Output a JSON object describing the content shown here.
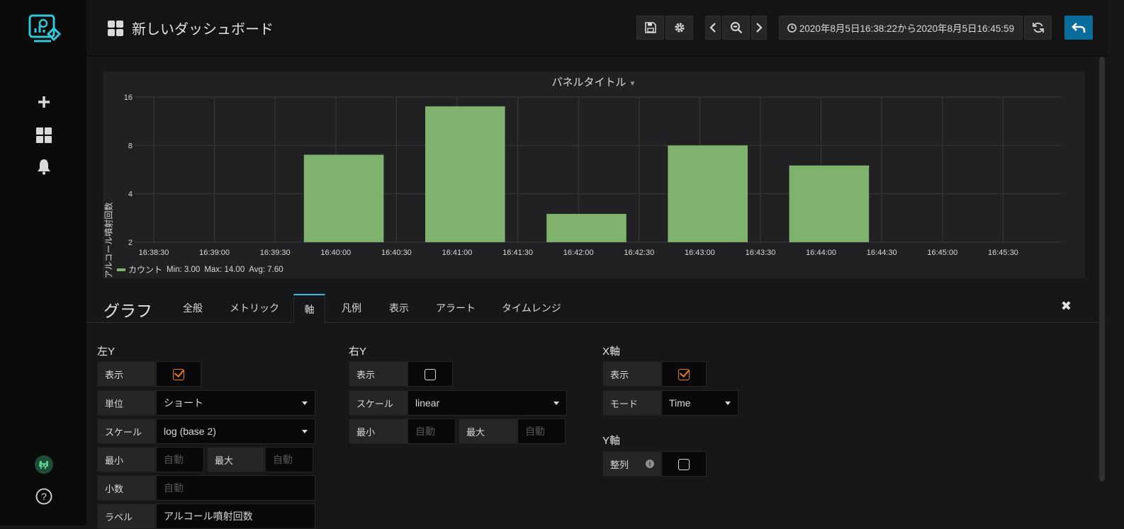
{
  "header": {
    "title": "新しいダッシュボード",
    "time_range": "2020年8月5日16:38:22から2020年8月5日16:45:59"
  },
  "sidebar": {
    "items": [
      "create-icon",
      "dashboards-icon",
      "alerts-icon",
      "profile-avatar",
      "help-icon"
    ]
  },
  "panel": {
    "title": "パネルタイトル",
    "y_axis_label": "アルコール噴射回数",
    "legend": {
      "series": "カウント",
      "min": "Min: 3.00",
      "max": "Max: 14.00",
      "avg": "Avg: 7.60"
    }
  },
  "chart_data": {
    "type": "bar",
    "title": "パネルタイトル",
    "ylabel": "アルコール噴射回数",
    "yscale": "log2",
    "ylim": [
      2,
      16
    ],
    "yticks": [
      "2",
      "4",
      "8",
      "16"
    ],
    "xticks": [
      "16:38:30",
      "16:39:00",
      "16:39:30",
      "16:40:00",
      "16:40:30",
      "16:41:00",
      "16:41:30",
      "16:42:00",
      "16:42:30",
      "16:43:00",
      "16:43:30",
      "16:44:00",
      "16:44:30",
      "16:45:00",
      "16:45:30"
    ],
    "series": [
      {
        "name": "カウント",
        "color": "#7eb26d",
        "points": [
          {
            "start": "16:40:00",
            "end": "16:40:30",
            "value": 7
          },
          {
            "start": "16:41:00",
            "end": "16:41:30",
            "value": 14
          },
          {
            "start": "16:42:00",
            "end": "16:42:30",
            "value": 3
          },
          {
            "start": "16:43:00",
            "end": "16:43:30",
            "value": 8
          },
          {
            "start": "16:44:00",
            "end": "16:44:30",
            "value": 6
          }
        ]
      }
    ],
    "grid": true,
    "legend": "bottom-left"
  },
  "editor": {
    "title": "グラフ",
    "tabs": [
      "全般",
      "メトリック",
      "軸",
      "凡例",
      "表示",
      "アラート",
      "タイムレンジ"
    ],
    "active_tab": "軸",
    "left_y": {
      "heading": "左Y",
      "show_label": "表示",
      "show": true,
      "unit_label": "単位",
      "unit_value": "ショート",
      "scale_label": "スケール",
      "scale_value": "log (base 2)",
      "min_label": "最小",
      "min_placeholder": "自動",
      "max_label": "最大",
      "max_placeholder": "自動",
      "decimals_label": "小数",
      "decimals_placeholder": "自動",
      "label_label": "ラベル",
      "label_value": "アルコール噴射回数"
    },
    "right_y": {
      "heading": "右Y",
      "show_label": "表示",
      "show": false,
      "scale_label": "スケール",
      "scale_value": "linear",
      "min_label": "最小",
      "min_placeholder": "自動",
      "max_label": "最大",
      "max_placeholder": "自動"
    },
    "x_axis": {
      "heading": "X軸",
      "show_label": "表示",
      "show": true,
      "mode_label": "モード",
      "mode_value": "Time"
    },
    "y_axes": {
      "heading": "Y軸",
      "align_label": "整列",
      "align": false
    }
  }
}
